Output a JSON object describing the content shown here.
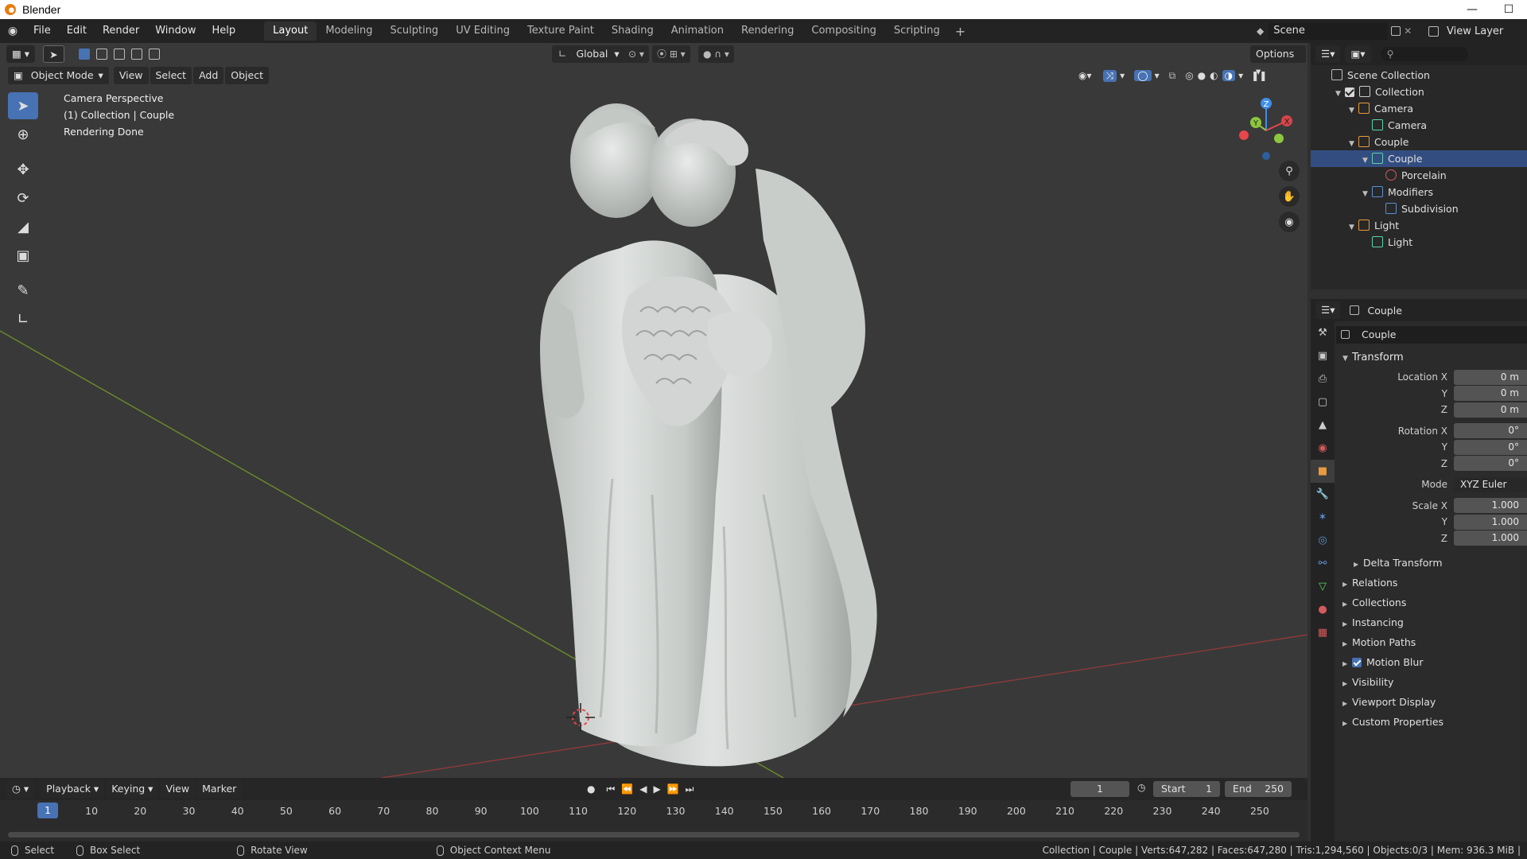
{
  "window": {
    "title": "Blender"
  },
  "menu": [
    "File",
    "Edit",
    "Render",
    "Window",
    "Help"
  ],
  "workspaces": [
    "Layout",
    "Modeling",
    "Sculpting",
    "UV Editing",
    "Texture Paint",
    "Shading",
    "Animation",
    "Rendering",
    "Compositing",
    "Scripting"
  ],
  "active_workspace": "Layout",
  "scene": {
    "name": "Scene",
    "view_layer": "View Layer"
  },
  "viewport": {
    "transform_orientation": "Global",
    "options_label": "Options",
    "mode": "Object Mode",
    "menus": [
      "View",
      "Select",
      "Add",
      "Object"
    ],
    "overlay_lines": [
      "Camera Perspective",
      "(1) Collection | Couple",
      "Rendering Done"
    ],
    "gizmo_axes": [
      "Z",
      "Y",
      "X"
    ],
    "colors": {
      "x_axis": "#e8464c",
      "y_axis": "#8cc63f",
      "z_axis": "#3f8fe8",
      "grid_x_line": "#8c3a3a",
      "grid_y_line": "#6b8c2a"
    }
  },
  "timeline": {
    "menus": [
      "Playback",
      "Keying",
      "View",
      "Marker"
    ],
    "current_frame": "1",
    "start_label": "Start",
    "start_value": "1",
    "end_label": "End",
    "end_value": "250",
    "ruler": [
      "1",
      "10",
      "20",
      "30",
      "40",
      "50",
      "60",
      "70",
      "80",
      "90",
      "100",
      "110",
      "120",
      "130",
      "140",
      "150",
      "160",
      "170",
      "180",
      "190",
      "200",
      "210",
      "220",
      "230",
      "240",
      "250"
    ]
  },
  "outliner": {
    "rows": [
      {
        "label": "Scene Collection",
        "icon": "scene-collection-icon",
        "level": 0
      },
      {
        "label": "Collection",
        "icon": "collection-icon",
        "level": 1
      },
      {
        "label": "Camera",
        "icon": "camera-object-icon",
        "level": 2
      },
      {
        "label": "Camera",
        "icon": "camera-data-icon",
        "level": 3
      },
      {
        "label": "Couple",
        "icon": "mesh-object-icon",
        "level": 2
      },
      {
        "label": "Couple",
        "icon": "mesh-data-icon",
        "level": 3,
        "selected": true
      },
      {
        "label": "Porcelain",
        "icon": "material-icon",
        "level": 4
      },
      {
        "label": "Modifiers",
        "icon": "wrench-icon",
        "level": 3
      },
      {
        "label": "Subdivision",
        "icon": "subdivision-modifier-icon",
        "level": 4
      },
      {
        "label": "Light",
        "icon": "light-object-icon",
        "level": 2
      },
      {
        "label": "Light",
        "icon": "light-data-icon",
        "level": 3
      }
    ]
  },
  "properties": {
    "context_object": "Couple",
    "object_name": "Couple",
    "transform_title": "Transform",
    "location": {
      "label": "Location X",
      "x": "0 m",
      "y": "0 m",
      "z": "0 m"
    },
    "rotation": {
      "label": "Rotation X",
      "x": "0°",
      "y": "0°",
      "z": "0°"
    },
    "mode": {
      "label": "Mode",
      "value": "XYZ Euler"
    },
    "scale": {
      "label": "Scale X",
      "x": "1.000",
      "y": "1.000",
      "z": "1.000"
    },
    "axis_labels": {
      "y": "Y",
      "z": "Z"
    },
    "delta_transform": "Delta Transform",
    "panels": [
      "Relations",
      "Collections",
      "Instancing",
      "Motion Paths",
      "Motion Blur",
      "Visibility",
      "Viewport Display",
      "Custom Properties"
    ]
  },
  "statusbar": {
    "items": [
      "Select",
      "Box Select",
      "Rotate View",
      "Object Context Menu"
    ],
    "info": "Collection | Couple | Verts:647,282 | Faces:647,280 | Tris:1,294,560 | Objects:0/3 | Mem: 936.3 MiB |"
  }
}
